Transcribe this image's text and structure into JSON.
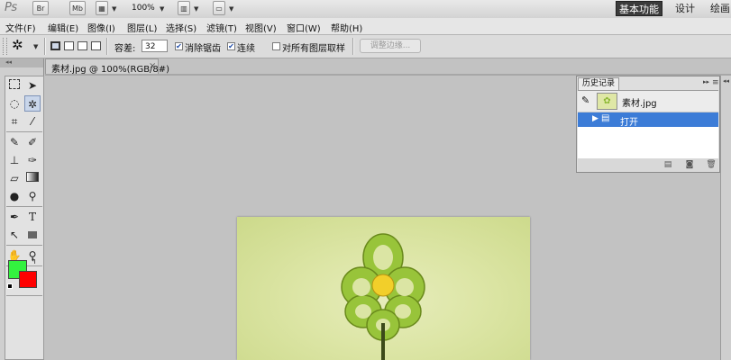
{
  "app": {
    "logo": "Ps",
    "bar_buttons": [
      "Br",
      "Mb"
    ],
    "zoom": "100%",
    "workspaces": [
      "基本功能",
      "设计",
      "绘画"
    ]
  },
  "menu": [
    "文件(F)",
    "编辑(E)",
    "图像(I)",
    "图层(L)",
    "选择(S)",
    "滤镜(T)",
    "视图(V)",
    "窗口(W)",
    "帮助(H)"
  ],
  "options": {
    "tolerance_label": "容差:",
    "tolerance_value": "32",
    "antialias_label": "消除锯齿",
    "antialias_checked": true,
    "contiguous_label": "连续",
    "contiguous_checked": true,
    "sample_all_label": "对所有图层取样",
    "sample_all_checked": false,
    "refine_button": "调整边缘..."
  },
  "document": {
    "tab_title": "素材.jpg @ 100%(RGB/8#)",
    "close": "×"
  },
  "colors": {
    "foreground": "#33f23f",
    "background": "#ff0000",
    "selection": "#3c7cd7"
  },
  "tools": [
    "rectangular-marquee",
    "move",
    "lasso",
    "magic-wand",
    "crop",
    "eyedropper",
    "spot-healing-brush",
    "brush",
    "clone-stamp",
    "history-brush",
    "eraser",
    "gradient",
    "blur",
    "dodge",
    "pen",
    "type",
    "path-selection",
    "rectangle-shape",
    "hand",
    "zoom"
  ],
  "history": {
    "tab": "历史记录",
    "snapshot": "素材.jpg",
    "steps": [
      "打开"
    ]
  }
}
